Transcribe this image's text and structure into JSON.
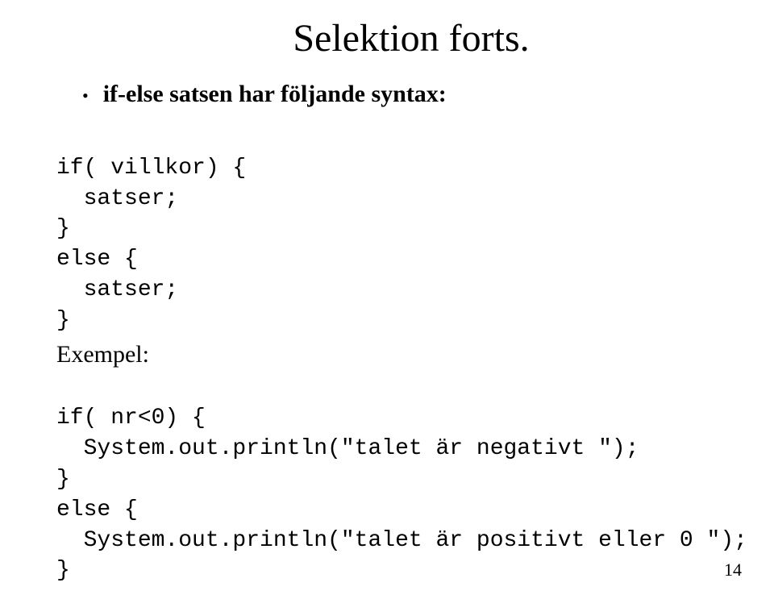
{
  "title": "Selektion forts.",
  "bullet": {
    "marker": "•",
    "text": "if-else satsen har följande syntax:"
  },
  "code_block_1": {
    "line1": "if( villkor) {",
    "line2": "  satser;",
    "line3": "}",
    "line4": "else {",
    "line5": "  satser;",
    "line6": "}"
  },
  "example_label": "Exempel:",
  "code_block_2": {
    "line1": "if( nr<0) {",
    "line2": "  System.out.println(\"talet är negativt \");",
    "line3": "}",
    "line4": "else {",
    "line5": "  System.out.println(\"talet är positivt eller 0 \");",
    "line6": "}"
  },
  "page_number": "14"
}
